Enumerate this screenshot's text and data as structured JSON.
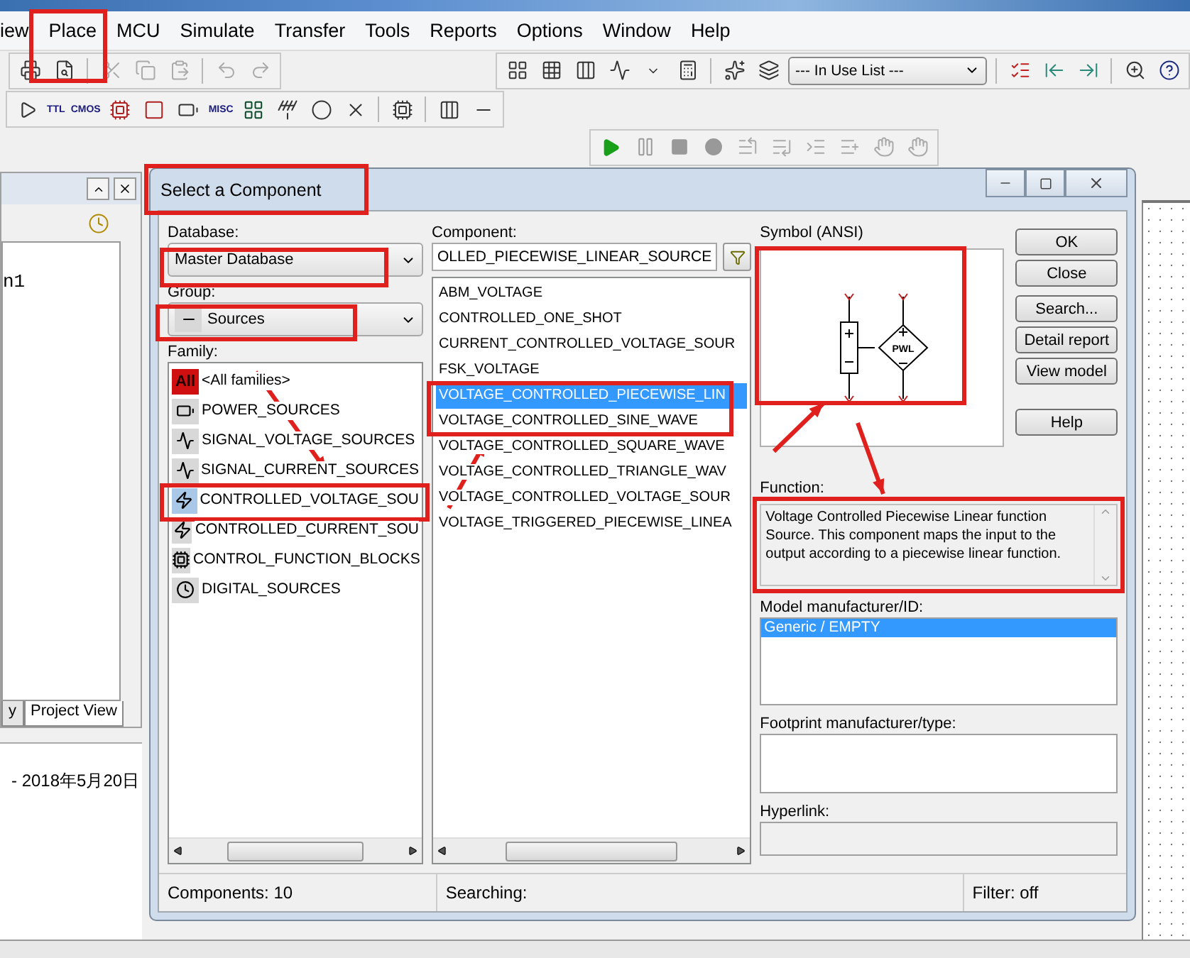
{
  "menu": [
    {
      "label": "iew"
    },
    {
      "label": "Place"
    },
    {
      "label": "MCU"
    },
    {
      "label": "Simulate"
    },
    {
      "label": "Transfer"
    },
    {
      "label": "Tools"
    },
    {
      "label": "Reports"
    },
    {
      "label": "Options"
    },
    {
      "label": "Window"
    },
    {
      "label": "Help"
    }
  ],
  "toolbar": {
    "in_use_list": "--- In Use List ---",
    "gate_labels": [
      "TTL",
      "CMOS"
    ],
    "misc_label": "MISC"
  },
  "left_panel": {
    "tree_item": "n1",
    "tabs": [
      {
        "label": "y",
        "selected": false
      },
      {
        "label": "Project View",
        "selected": true
      }
    ]
  },
  "log_line": "-  2018年5月20日",
  "dialog": {
    "title": "Select a Component",
    "database": {
      "label": "Database:",
      "value": "Master Database"
    },
    "group": {
      "label": "Group:",
      "value": "Sources"
    },
    "family": {
      "label": "Family:",
      "all_badge": "All",
      "items": [
        {
          "label": "<All families>",
          "selected": false
        },
        {
          "label": "POWER_SOURCES",
          "selected": false
        },
        {
          "label": "SIGNAL_VOLTAGE_SOURCES",
          "selected": false
        },
        {
          "label": "SIGNAL_CURRENT_SOURCES",
          "selected": false
        },
        {
          "label": "CONTROLLED_VOLTAGE_SOU",
          "selected": true
        },
        {
          "label": "CONTROLLED_CURRENT_SOU",
          "selected": false
        },
        {
          "label": "CONTROL_FUNCTION_BLOCKS",
          "selected": false
        },
        {
          "label": "DIGITAL_SOURCES",
          "selected": false
        }
      ]
    },
    "component": {
      "label": "Component:",
      "value": "OLLED_PIECEWISE_LINEAR_SOURCE",
      "items": [
        {
          "label": "ABM_VOLTAGE",
          "selected": false
        },
        {
          "label": "CONTROLLED_ONE_SHOT",
          "selected": false
        },
        {
          "label": "CURRENT_CONTROLLED_VOLTAGE_SOUR",
          "selected": false
        },
        {
          "label": "FSK_VOLTAGE",
          "selected": false
        },
        {
          "label": "VOLTAGE_CONTROLLED_PIECEWISE_LIN",
          "selected": true
        },
        {
          "label": "VOLTAGE_CONTROLLED_SINE_WAVE",
          "selected": false
        },
        {
          "label": "VOLTAGE_CONTROLLED_SQUARE_WAVE",
          "selected": false
        },
        {
          "label": "VOLTAGE_CONTROLLED_TRIANGLE_WAV",
          "selected": false
        },
        {
          "label": "VOLTAGE_CONTROLLED_VOLTAGE_SOUR",
          "selected": false
        },
        {
          "label": "VOLTAGE_TRIGGERED_PIECEWISE_LINEA",
          "selected": false
        }
      ]
    },
    "symbol": {
      "label": "Symbol (ANSI)",
      "source_label": "PWL"
    },
    "buttons": [
      "OK",
      "Close",
      "Search...",
      "Detail report",
      "View model",
      "Help"
    ],
    "function": {
      "label": "Function:",
      "text": "Voltage Controlled Piecewise Linear function Source. This component maps the input to the output according to a piecewise linear function."
    },
    "model": {
      "label": "Model manufacturer/ID:",
      "items": [
        {
          "label": "Generic / EMPTY",
          "selected": true
        }
      ]
    },
    "footprint": {
      "label": "Footprint manufacturer/type:"
    },
    "hyperlink": {
      "label": "Hyperlink:"
    },
    "status": {
      "count": "Components: 10",
      "searching": "Searching:",
      "filter": "Filter: off"
    }
  }
}
